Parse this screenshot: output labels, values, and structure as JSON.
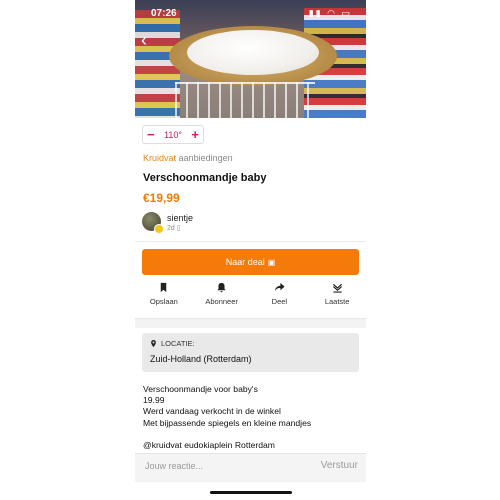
{
  "status_bar": {
    "time": "07:26",
    "icons": "▮▮ ◠ ▭"
  },
  "hero": {
    "back_icon": "back-arrow-icon"
  },
  "temperature": {
    "minus": "−",
    "value": "110°",
    "plus": "+"
  },
  "deal": {
    "merchant": "Kruidvat",
    "merchant_suffix": "aanbiedingen",
    "title": "Verschoonmandje baby",
    "price": "€19,99"
  },
  "user": {
    "name": "sientje",
    "posted": "2d"
  },
  "cta": {
    "label": "Naar deal"
  },
  "actions": [
    {
      "label": "Opslaan",
      "icon": "bookmark-icon"
    },
    {
      "label": "Abonneer",
      "icon": "bell-icon"
    },
    {
      "label": "Deel",
      "icon": "share-icon"
    },
    {
      "label": "Laatste",
      "icon": "jump-latest-icon"
    }
  ],
  "location": {
    "label": "LOCATIE:",
    "value": "Zuid-Holland (Rotterdam)"
  },
  "description": {
    "line1": "Verschoonmandje voor baby's",
    "line2": "19.99",
    "line3": "Werd vandaag verkocht in de winkel",
    "line4": "Met bijpassende spiegels en kleine mandjes",
    "line5": "@kruidvat eudokiaplein Rotterdam"
  },
  "comment": {
    "placeholder": "Jouw reactie...",
    "send": "Verstuur"
  },
  "colors": {
    "accent": "#f47b09",
    "temp": "#d01e55",
    "merchant": "#e48425"
  }
}
